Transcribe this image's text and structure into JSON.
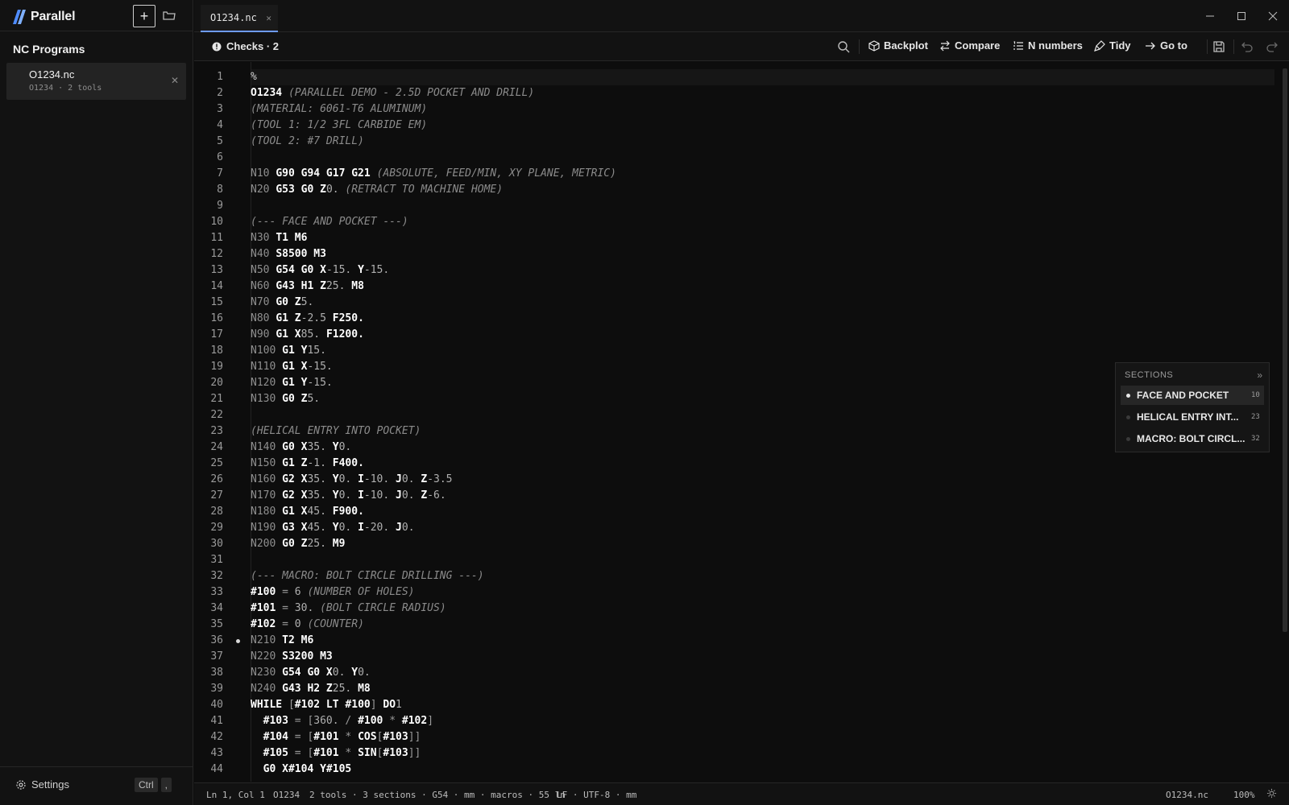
{
  "app": {
    "name": "Parallel"
  },
  "sidebar": {
    "title": "NC Programs",
    "files": [
      {
        "name": "O1234.nc",
        "meta": "O1234 · 2 tools"
      }
    ],
    "settings_label": "Settings",
    "shortcut": [
      "Ctrl",
      ","
    ]
  },
  "tabs": [
    {
      "label": "O1234.nc"
    }
  ],
  "toolbar": {
    "checks_label": "Checks · 2",
    "backplot": "Backplot",
    "compare": "Compare",
    "nnumbers": "N numbers",
    "tidy": "Tidy",
    "goto": "Go to"
  },
  "editor": {
    "current_line": 1,
    "bookmark_line": 36,
    "lines": [
      [
        [
          "t",
          "%"
        ]
      ],
      [
        [
          "p",
          "O1234"
        ],
        [
          "t",
          " "
        ],
        [
          "c",
          "(PARALLEL DEMO - 2.5D POCKET AND DRILL)"
        ]
      ],
      [
        [
          "c",
          "(MATERIAL: 6061-T6 ALUMINUM)"
        ]
      ],
      [
        [
          "c",
          "(TOOL 1: 1/2 3FL CARBIDE EM)"
        ]
      ],
      [
        [
          "c",
          "(TOOL 2: #7 DRILL)"
        ]
      ],
      [],
      [
        [
          "n",
          "N10 "
        ],
        [
          "k",
          "G90 G94 G17 G21"
        ],
        [
          "t",
          " "
        ],
        [
          "c",
          "(ABSOLUTE, FEED/MIN, XY PLANE, METRIC)"
        ]
      ],
      [
        [
          "n",
          "N20 "
        ],
        [
          "k",
          "G53 G0 "
        ],
        [
          "k",
          "Z"
        ],
        [
          "d",
          "0. "
        ],
        [
          "c",
          "(RETRACT TO MACHINE HOME)"
        ]
      ],
      [],
      [
        [
          "c",
          "(--- FACE AND POCKET ---)"
        ]
      ],
      [
        [
          "n",
          "N30 "
        ],
        [
          "k",
          "T1 M6"
        ]
      ],
      [
        [
          "n",
          "N40 "
        ],
        [
          "k",
          "S8500 M3"
        ]
      ],
      [
        [
          "n",
          "N50 "
        ],
        [
          "k",
          "G54 G0 X"
        ],
        [
          "d",
          "-15. "
        ],
        [
          "k",
          "Y"
        ],
        [
          "d",
          "-15."
        ]
      ],
      [
        [
          "n",
          "N60 "
        ],
        [
          "k",
          "G43 "
        ],
        [
          "k",
          "H1 Z"
        ],
        [
          "d",
          "25. "
        ],
        [
          "k",
          "M8"
        ]
      ],
      [
        [
          "n",
          "N70 "
        ],
        [
          "k",
          "G0 Z"
        ],
        [
          "d",
          "5."
        ]
      ],
      [
        [
          "n",
          "N80 "
        ],
        [
          "k",
          "G1 Z"
        ],
        [
          "d",
          "-2.5 "
        ],
        [
          "k",
          "F250."
        ]
      ],
      [
        [
          "n",
          "N90 "
        ],
        [
          "k",
          "G1 X"
        ],
        [
          "d",
          "85. "
        ],
        [
          "k",
          "F1200."
        ]
      ],
      [
        [
          "n",
          "N100 "
        ],
        [
          "k",
          "G1 Y"
        ],
        [
          "d",
          "15."
        ]
      ],
      [
        [
          "n",
          "N110 "
        ],
        [
          "k",
          "G1 X"
        ],
        [
          "d",
          "-15."
        ]
      ],
      [
        [
          "n",
          "N120 "
        ],
        [
          "k",
          "G1 Y"
        ],
        [
          "d",
          "-15."
        ]
      ],
      [
        [
          "n",
          "N130 "
        ],
        [
          "k",
          "G0 Z"
        ],
        [
          "d",
          "5."
        ]
      ],
      [],
      [
        [
          "c",
          "(HELICAL ENTRY INTO POCKET)"
        ]
      ],
      [
        [
          "n",
          "N140 "
        ],
        [
          "k",
          "G0 X"
        ],
        [
          "d",
          "35. "
        ],
        [
          "k",
          "Y"
        ],
        [
          "d",
          "0."
        ]
      ],
      [
        [
          "n",
          "N150 "
        ],
        [
          "k",
          "G1 Z"
        ],
        [
          "d",
          "-1. "
        ],
        [
          "k",
          "F400."
        ]
      ],
      [
        [
          "n",
          "N160 "
        ],
        [
          "k",
          "G2 X"
        ],
        [
          "d",
          "35. "
        ],
        [
          "k",
          "Y"
        ],
        [
          "d",
          "0. "
        ],
        [
          "k",
          "I"
        ],
        [
          "d",
          "-10. "
        ],
        [
          "k",
          "J"
        ],
        [
          "d",
          "0. "
        ],
        [
          "k",
          "Z"
        ],
        [
          "d",
          "-3.5"
        ]
      ],
      [
        [
          "n",
          "N170 "
        ],
        [
          "k",
          "G2 X"
        ],
        [
          "d",
          "35. "
        ],
        [
          "k",
          "Y"
        ],
        [
          "d",
          "0. "
        ],
        [
          "k",
          "I"
        ],
        [
          "d",
          "-10. "
        ],
        [
          "k",
          "J"
        ],
        [
          "d",
          "0. "
        ],
        [
          "k",
          "Z"
        ],
        [
          "d",
          "-6."
        ]
      ],
      [
        [
          "n",
          "N180 "
        ],
        [
          "k",
          "G1 X"
        ],
        [
          "d",
          "45. "
        ],
        [
          "k",
          "F900."
        ]
      ],
      [
        [
          "n",
          "N190 "
        ],
        [
          "k",
          "G3 X"
        ],
        [
          "d",
          "45. "
        ],
        [
          "k",
          "Y"
        ],
        [
          "d",
          "0. "
        ],
        [
          "k",
          "I"
        ],
        [
          "d",
          "-20. "
        ],
        [
          "k",
          "J"
        ],
        [
          "d",
          "0."
        ]
      ],
      [
        [
          "n",
          "N200 "
        ],
        [
          "k",
          "G0 Z"
        ],
        [
          "d",
          "25. "
        ],
        [
          "k",
          "M9"
        ]
      ],
      [],
      [
        [
          "c",
          "(--- MACRO: BOLT CIRCLE DRILLING ---)"
        ]
      ],
      [
        [
          "v",
          "#100"
        ],
        [
          "o",
          " = "
        ],
        [
          "d",
          "6 "
        ],
        [
          "c",
          "(NUMBER OF HOLES)"
        ]
      ],
      [
        [
          "v",
          "#101"
        ],
        [
          "o",
          " = "
        ],
        [
          "d",
          "30. "
        ],
        [
          "c",
          "(BOLT CIRCLE RADIUS)"
        ]
      ],
      [
        [
          "v",
          "#102"
        ],
        [
          "o",
          " = "
        ],
        [
          "d",
          "0 "
        ],
        [
          "c",
          "(COUNTER)"
        ]
      ],
      [
        [
          "n",
          "N210 "
        ],
        [
          "k",
          "T2 M6"
        ]
      ],
      [
        [
          "n",
          "N220 "
        ],
        [
          "k",
          "S3200 M3"
        ]
      ],
      [
        [
          "n",
          "N230 "
        ],
        [
          "k",
          "G54 G0 X"
        ],
        [
          "d",
          "0. "
        ],
        [
          "k",
          "Y"
        ],
        [
          "d",
          "0."
        ]
      ],
      [
        [
          "n",
          "N240 "
        ],
        [
          "k",
          "G43 H2 Z"
        ],
        [
          "d",
          "25. "
        ],
        [
          "k",
          "M8"
        ]
      ],
      [
        [
          "k",
          "WHILE "
        ],
        [
          "o",
          "["
        ],
        [
          "k",
          "#102 LT #100"
        ],
        [
          "o",
          "] "
        ],
        [
          "k",
          "DO"
        ],
        [
          "d",
          "1"
        ]
      ],
      [
        [
          "t",
          "  "
        ],
        [
          "v",
          "#103"
        ],
        [
          "o",
          " = ["
        ],
        [
          "d",
          "360. "
        ],
        [
          "o",
          "/ "
        ],
        [
          "v",
          "#100"
        ],
        [
          "o",
          " * "
        ],
        [
          "v",
          "#102"
        ],
        [
          "o",
          "]"
        ]
      ],
      [
        [
          "t",
          "  "
        ],
        [
          "v",
          "#104"
        ],
        [
          "o",
          " = ["
        ],
        [
          "v",
          "#101"
        ],
        [
          "o",
          " * "
        ],
        [
          "k",
          "COS"
        ],
        [
          "o",
          "["
        ],
        [
          "v",
          "#103"
        ],
        [
          "o",
          "]]"
        ]
      ],
      [
        [
          "t",
          "  "
        ],
        [
          "v",
          "#105"
        ],
        [
          "o",
          " = ["
        ],
        [
          "v",
          "#101"
        ],
        [
          "o",
          " * "
        ],
        [
          "k",
          "SIN"
        ],
        [
          "o",
          "["
        ],
        [
          "v",
          "#103"
        ],
        [
          "o",
          "]]"
        ]
      ],
      [
        [
          "t",
          "  "
        ],
        [
          "k",
          "G0 X#104 Y#105"
        ]
      ]
    ]
  },
  "sections_panel": {
    "title": "SECTIONS",
    "items": [
      {
        "label": "FACE AND POCKET",
        "line": "10",
        "active": true
      },
      {
        "label": "HELICAL ENTRY INT...",
        "line": "23",
        "active": false
      },
      {
        "label": "MACRO: BOLT CIRCL...",
        "line": "32",
        "active": false
      }
    ]
  },
  "statusbar": {
    "position": "Ln 1, Col 1",
    "program": "O1234",
    "summary": "2 tools · 3 sections · G54 · mm · macros · 55 ln",
    "encoding": "LF · UTF-8 · mm",
    "file": "O1234.nc",
    "zoom": "100%"
  }
}
